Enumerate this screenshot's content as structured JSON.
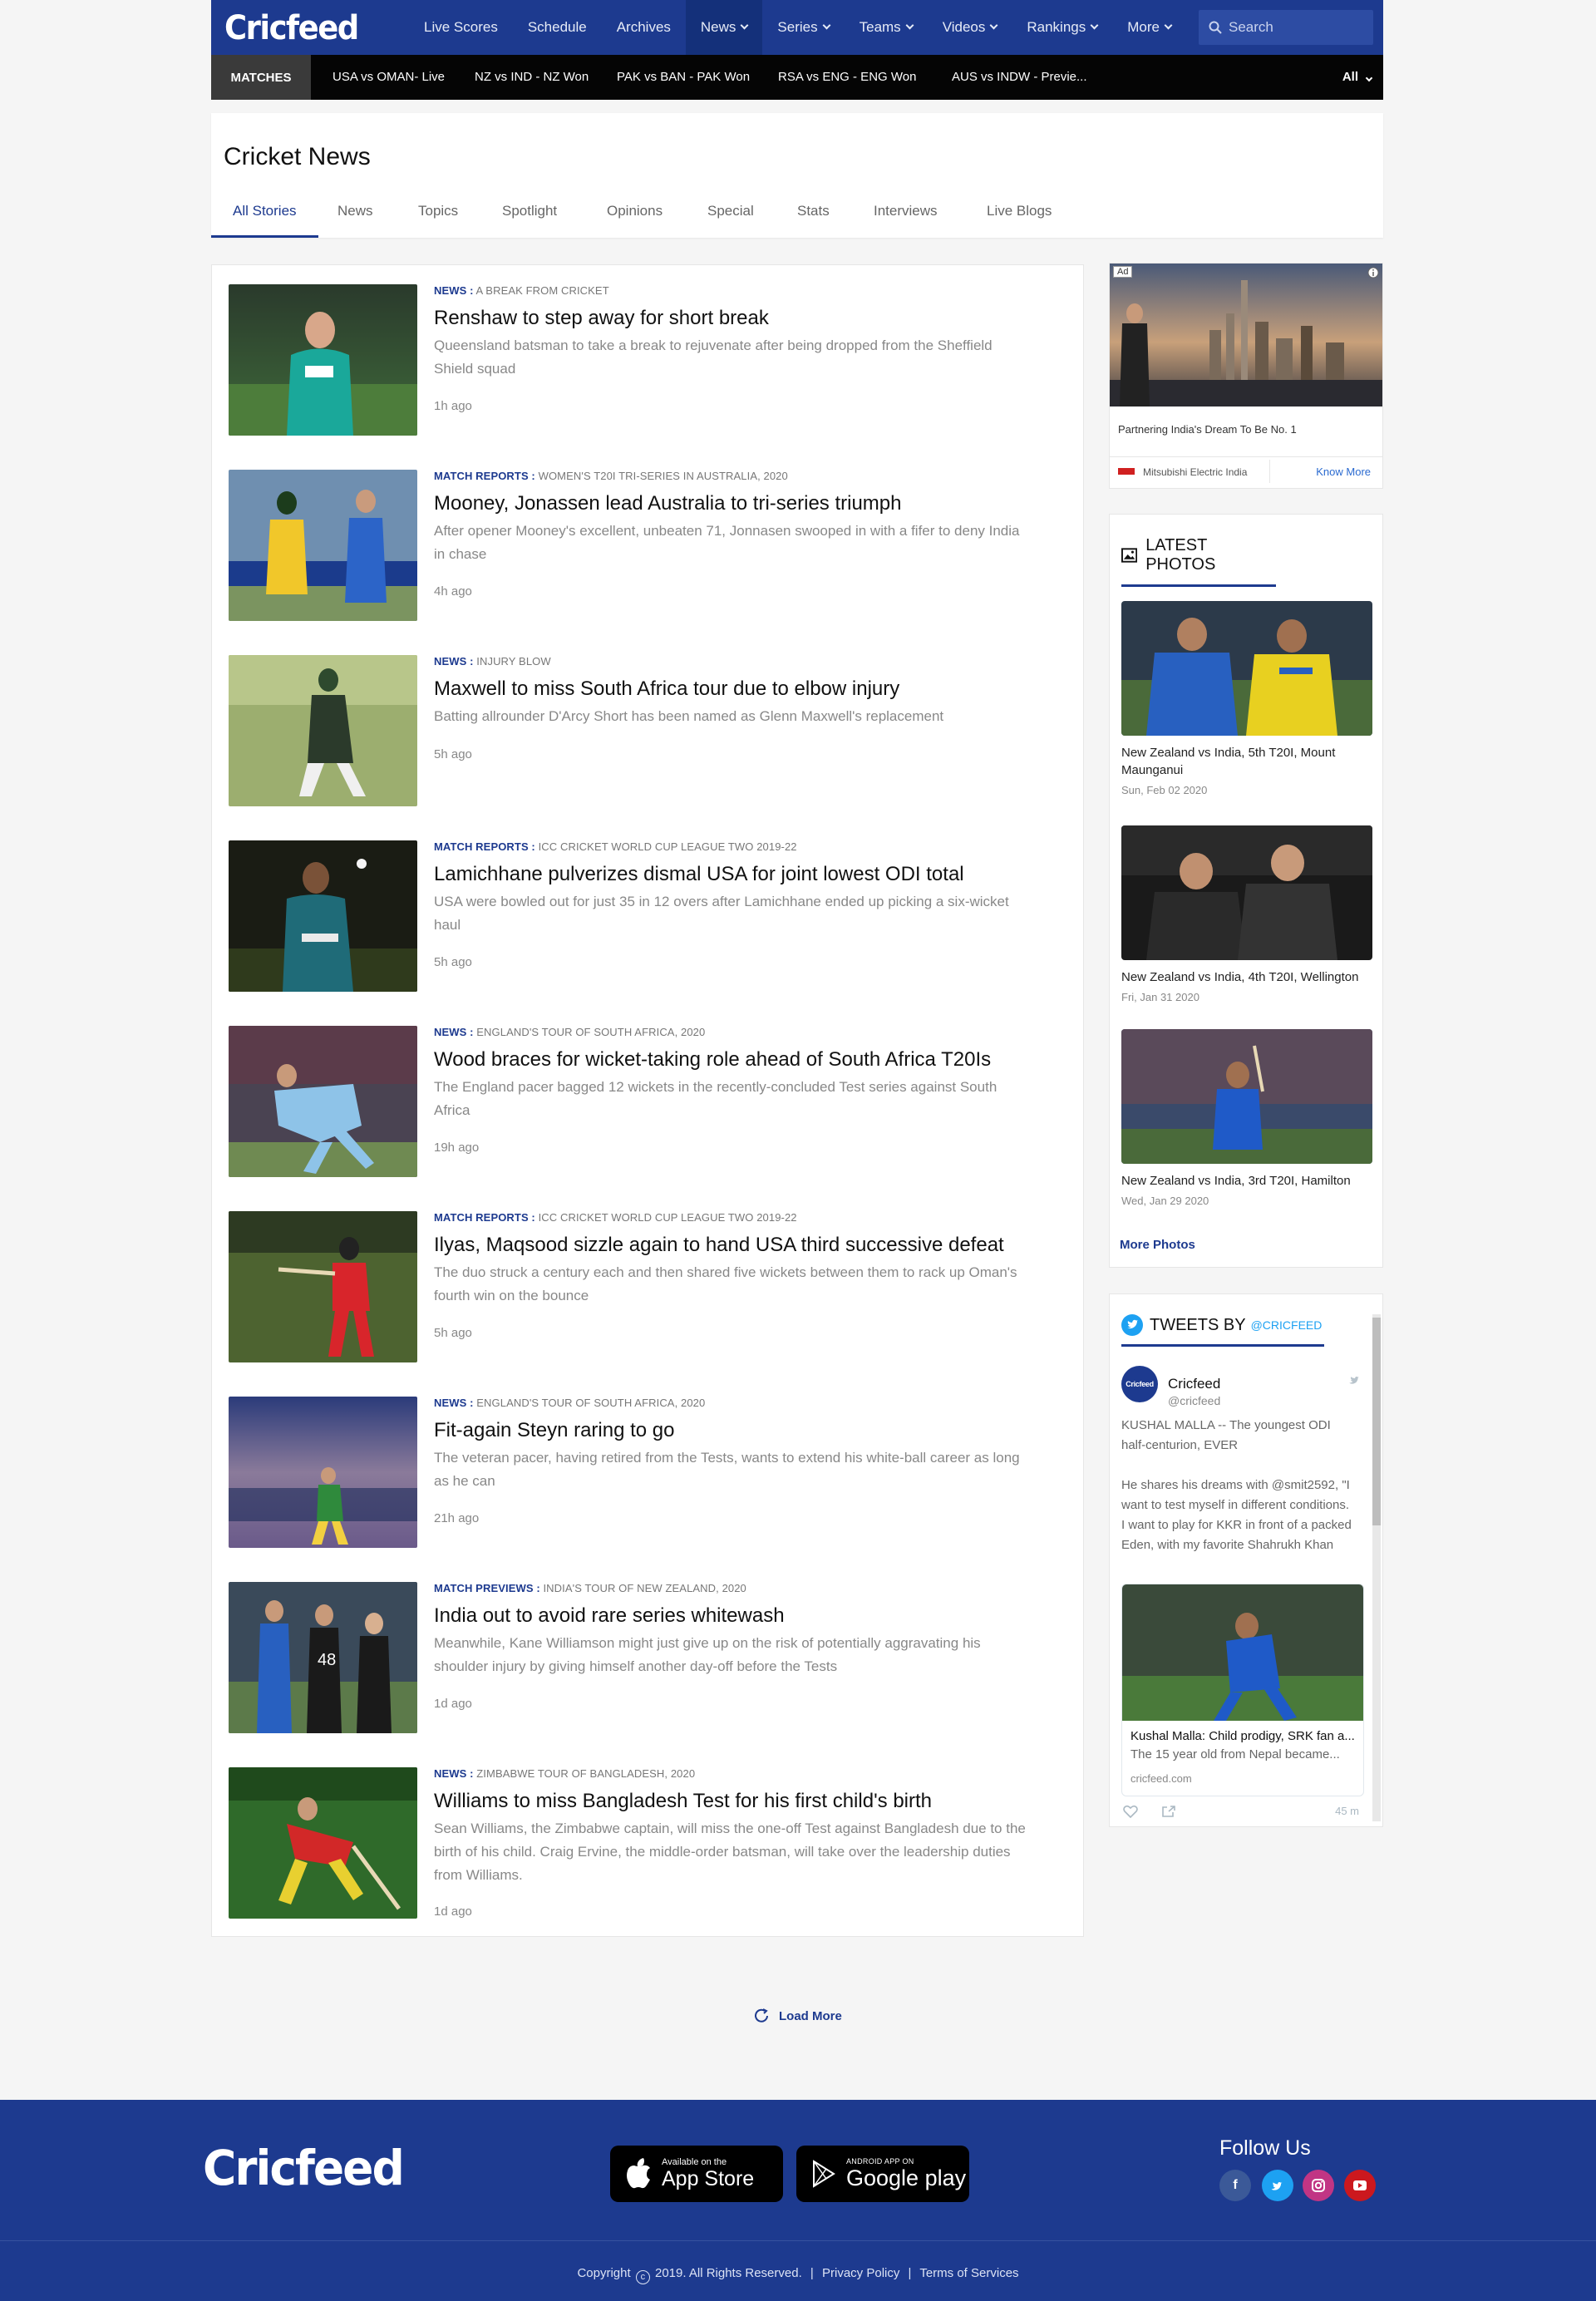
{
  "header": {
    "logo": "Cricfeed",
    "nav": [
      {
        "label": "Live Scores",
        "dropdown": false
      },
      {
        "label": "Schedule",
        "dropdown": false
      },
      {
        "label": "Archives",
        "dropdown": false
      },
      {
        "label": "News",
        "dropdown": true,
        "active": true
      },
      {
        "label": "Series",
        "dropdown": true
      },
      {
        "label": "Teams",
        "dropdown": true
      },
      {
        "label": "Videos",
        "dropdown": true
      },
      {
        "label": "Rankings",
        "dropdown": true
      },
      {
        "label": "More",
        "dropdown": true
      }
    ],
    "search_placeholder": "Search"
  },
  "matchbar": {
    "label": "MATCHES",
    "matches": [
      "USA vs OMAN- Live",
      "NZ vs IND - NZ Won",
      "PAK vs BAN - PAK Won",
      "RSA vs  ENG - ENG Won",
      "AUS vs INDW - Previe..."
    ],
    "filter": "All"
  },
  "news_header": {
    "title": "Cricket News",
    "tabs": [
      "All Stories",
      "News",
      "Topics",
      "Spotlight",
      "Opinions",
      "Special",
      "Stats",
      "Interviews",
      "Live Blogs"
    ],
    "active_tab": "All Stories"
  },
  "articles": [
    {
      "category": "NEWS :",
      "topic": "A BREAK FROM CRICKET",
      "title": "Renshaw to step away for short break",
      "description": "Queensland batsman to take a break to rejuvenate after being dropped from the Sheffield Shield squad",
      "time": "1h ago"
    },
    {
      "category": "MATCH REPORTS :",
      "topic": "WOMEN'S T20I TRI-SERIES IN AUSTRALIA, 2020",
      "title": "Mooney, Jonassen lead Australia to tri-series triumph",
      "description": "After opener Mooney's excellent, unbeaten 71, Jonnasen swooped in with a fifer to deny India in chase",
      "time": "4h ago"
    },
    {
      "category": "NEWS :",
      "topic": "INJURY BLOW",
      "title": "Maxwell to miss South Africa tour due to elbow injury",
      "description": "Batting allrounder D'Arcy Short has been named as Glenn Maxwell's replacement",
      "time": "5h ago"
    },
    {
      "category": "MATCH REPORTS :",
      "topic": "ICC CRICKET WORLD CUP LEAGUE TWO 2019-22",
      "title": "Lamichhane pulverizes dismal USA for joint lowest ODI total",
      "description": "USA were bowled out for just 35 in 12 overs after Lamichhane ended up picking a six-wicket haul",
      "time": "5h ago"
    },
    {
      "category": "NEWS :",
      "topic": "ENGLAND'S TOUR OF SOUTH AFRICA, 2020",
      "title": "Wood braces for wicket-taking role ahead of South Africa T20Is",
      "description": "The England pacer bagged 12 wickets in the recently-concluded Test series against South Africa",
      "time": "19h ago"
    },
    {
      "category": "MATCH REPORTS :",
      "topic": "ICC CRICKET WORLD CUP LEAGUE TWO 2019-22",
      "title": "Ilyas, Maqsood sizzle again to hand USA third successive defeat",
      "description": "The duo struck a century each and then shared five wickets between them to rack up Oman's fourth win on the bounce",
      "time": "5h ago"
    },
    {
      "category": "NEWS :",
      "topic": "ENGLAND'S TOUR OF SOUTH AFRICA, 2020",
      "title": "Fit-again Steyn raring to go",
      "description": "The veteran pacer, having retired from the Tests, wants to extend his white-ball career as long as he can",
      "time": "21h ago"
    },
    {
      "category": "MATCH PREVIEWS :",
      "topic": "INDIA'S TOUR OF NEW ZEALAND, 2020",
      "title": "India out to avoid rare series whitewash",
      "description": "Meanwhile, Kane Williamson might just give up on the risk of potentially aggravating his shoulder injury by giving himself another day-off before the Tests",
      "time": "1d ago"
    },
    {
      "category": "NEWS :",
      "topic": "ZIMBABWE TOUR OF BANGLADESH, 2020",
      "title": "Williams to miss Bangladesh Test for his first child's birth",
      "description": "Sean Williams, the Zimbabwe captain, will miss the one-off Test against Bangladesh due to the birth of his child. Craig Ervine, the middle-order batsman, will take over the leadership duties from Williams.",
      "time": "1d ago"
    }
  ],
  "ad": {
    "badge": "Ad",
    "headline": "Partnering India's Dream To Be No. 1",
    "advertiser": "Mitsubishi Electric India",
    "cta": "Know More"
  },
  "latest_photos": {
    "title": "LATEST PHOTOS",
    "items": [
      {
        "caption": "New Zealand vs India, 5th T20I, Mount Maunganui",
        "date": "Sun, Feb 02 2020"
      },
      {
        "caption": "New Zealand vs India, 4th T20I, Wellington",
        "date": "Fri, Jan 31 2020"
      },
      {
        "caption": "New Zealand vs India, 3rd T20I, Hamilton",
        "date": "Wed, Jan 29 2020"
      }
    ],
    "more_link": "More Photos"
  },
  "tweets": {
    "title": "TWEETS BY",
    "handle_link": "@CRICFEED",
    "author_name": "Cricfeed",
    "author_handle": "@cricfeed",
    "text_1": "KUSHAL MALLA -- The youngest ODI half-centurion, EVER",
    "text_2": "He shares his dreams with @smit2592, \"I want to test myself in different conditions. I want to play for KKR in front of a packed Eden, with my favorite Shahrukh Khan cheering",
    "card_title": "Kushal Malla: Child prodigy, SRK fan a...",
    "card_desc": "The 15 year old from Nepal became...",
    "card_domain": "cricfeed.com",
    "time": "45 m"
  },
  "load_more": "Load More",
  "footer": {
    "logo": "Cricfeed",
    "appstore_small": "Available on the",
    "appstore_big": "App Store",
    "googleplay_small": "ANDROID APP ON",
    "googleplay_big": "Google play",
    "follow_us": "Follow Us",
    "copyright": "Copyright",
    "copyright_rest": "2019. All Rights Reserved.",
    "privacy": "Privacy Policy",
    "terms": "Terms of Services"
  },
  "colors": {
    "brand_blue": "#1d3a8f",
    "matchbar_bg": "#050505",
    "page_bg": "#f5f5f5",
    "twitter_blue": "#1da1f2"
  }
}
